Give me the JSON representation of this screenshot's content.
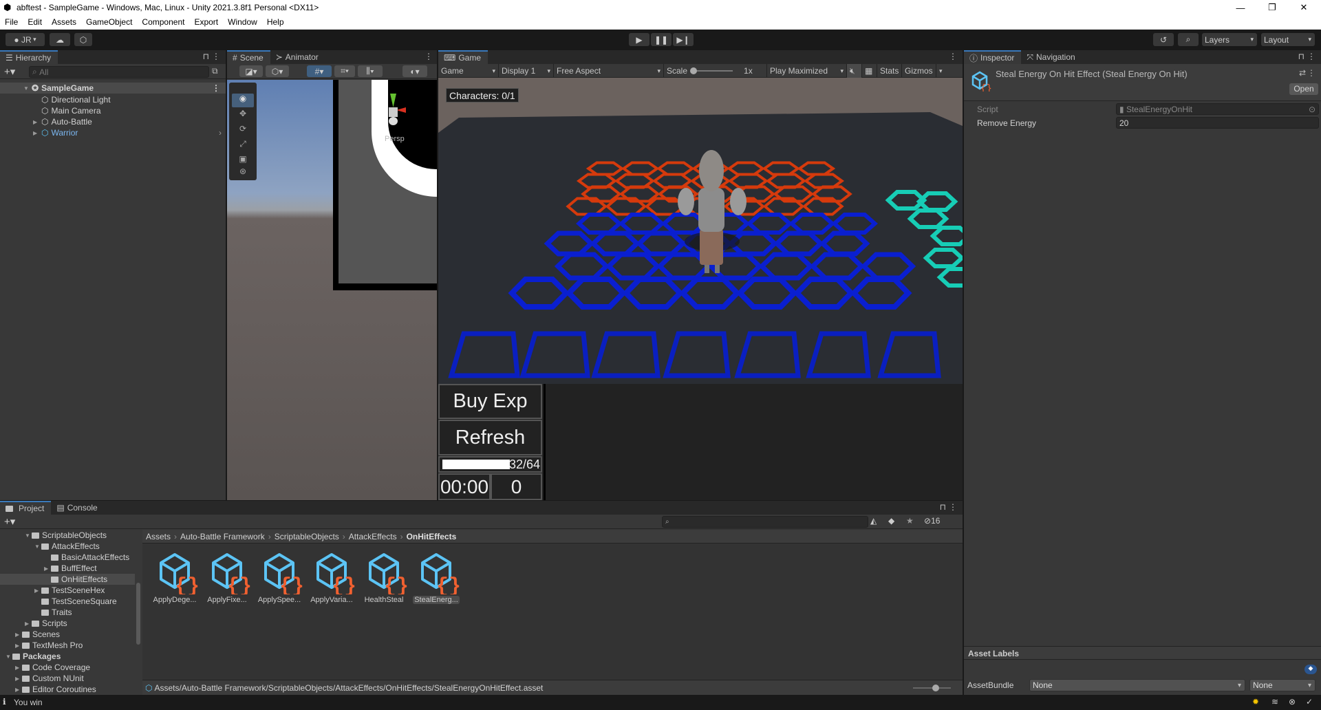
{
  "window": {
    "title": "abftest - SampleGame - Windows, Mac, Linux - Unity 2021.3.8f1 Personal <DX11>",
    "minimize": "—",
    "maximize": "❐",
    "close": "✕"
  },
  "menu": [
    "File",
    "Edit",
    "Assets",
    "GameObject",
    "Component",
    "Export",
    "Window",
    "Help"
  ],
  "toolbar": {
    "account": "JR",
    "layers": "Layers",
    "layout": "Layout"
  },
  "hierarchy": {
    "tab": "Hierarchy",
    "search_placeholder": "All",
    "scene": "SampleGame",
    "items": [
      {
        "label": "Directional Light",
        "expandable": false,
        "prefab": false
      },
      {
        "label": "Main Camera",
        "expandable": false,
        "prefab": false
      },
      {
        "label": "Auto-Battle",
        "expandable": true,
        "prefab": false
      },
      {
        "label": "Warrior",
        "expandable": true,
        "prefab": true
      }
    ]
  },
  "scene": {
    "tabs": [
      "Scene",
      "Animator"
    ],
    "gizmo_label": "Persp"
  },
  "game": {
    "tab": "Game",
    "mode": "Game",
    "display": "Display 1",
    "aspect": "Free Aspect",
    "scale_label": "Scale",
    "scale_value": "1x",
    "play_mode": "Play Maximized",
    "stats": "Stats",
    "gizmos": "Gizmos",
    "characters": "Characters: 0/1",
    "buy_exp": "Buy Exp",
    "refresh": "Refresh",
    "exp_text": "32/64",
    "exp_fill": 1.0,
    "timer": "00:00",
    "gold": "0",
    "colors": {
      "enemy_tiles": "#d63a0c",
      "player_tiles": "#0a1fd0",
      "bench_tiles": "#0a1fc0",
      "other_tiles": "#17cdb6"
    }
  },
  "inspector": {
    "tabs": [
      "Inspector",
      "Navigation"
    ],
    "title": "Steal Energy On Hit Effect (Steal Energy On Hit)",
    "open": "Open",
    "fields": [
      {
        "label": "Script",
        "value": "StealEnergyOnHit"
      },
      {
        "label": "Remove Energy",
        "value": "20"
      }
    ],
    "asset_labels": "Asset Labels",
    "asset_bundle_label": "AssetBundle",
    "asset_bundle": "None",
    "asset_variant": "None"
  },
  "project": {
    "tabs": [
      "Project",
      "Console"
    ],
    "hidden_count": "16",
    "tree": [
      {
        "label": "ScriptableObjects",
        "depth": 2,
        "state": "open"
      },
      {
        "label": "AttackEffects",
        "depth": 3,
        "state": "open"
      },
      {
        "label": "BasicAttackEffects",
        "depth": 4,
        "state": "none"
      },
      {
        "label": "BuffEffect",
        "depth": 4,
        "state": "closed"
      },
      {
        "label": "OnHitEffects",
        "depth": 4,
        "state": "none",
        "selected": true
      },
      {
        "label": "TestSceneHex",
        "depth": 3,
        "state": "closed"
      },
      {
        "label": "TestSceneSquare",
        "depth": 3,
        "state": "none"
      },
      {
        "label": "Traits",
        "depth": 3,
        "state": "none"
      },
      {
        "label": "Scripts",
        "depth": 2,
        "state": "closed"
      },
      {
        "label": "Scenes",
        "depth": 1,
        "state": "closed"
      },
      {
        "label": "TextMesh Pro",
        "depth": 1,
        "state": "closed"
      },
      {
        "label": "Packages",
        "depth": 0,
        "state": "open",
        "bold": true
      },
      {
        "label": "Code Coverage",
        "depth": 1,
        "state": "closed"
      },
      {
        "label": "Custom NUnit",
        "depth": 1,
        "state": "closed"
      },
      {
        "label": "Editor Coroutines",
        "depth": 1,
        "state": "closed"
      }
    ],
    "breadcrumb": [
      "Assets",
      "Auto-Battle Framework",
      "ScriptableObjects",
      "AttackEffects",
      "OnHitEffects"
    ],
    "assets": [
      "ApplyDege...",
      "ApplyFixe...",
      "ApplySpee...",
      "ApplyVaria...",
      "HealthSteal",
      "StealEnerg..."
    ],
    "selected_asset": 5,
    "path": "Assets/Auto-Battle Framework/ScriptableObjects/AttackEffects/OnHitEffects/StealEnergyOnHitEffect.asset"
  },
  "status": {
    "message": "You win"
  }
}
